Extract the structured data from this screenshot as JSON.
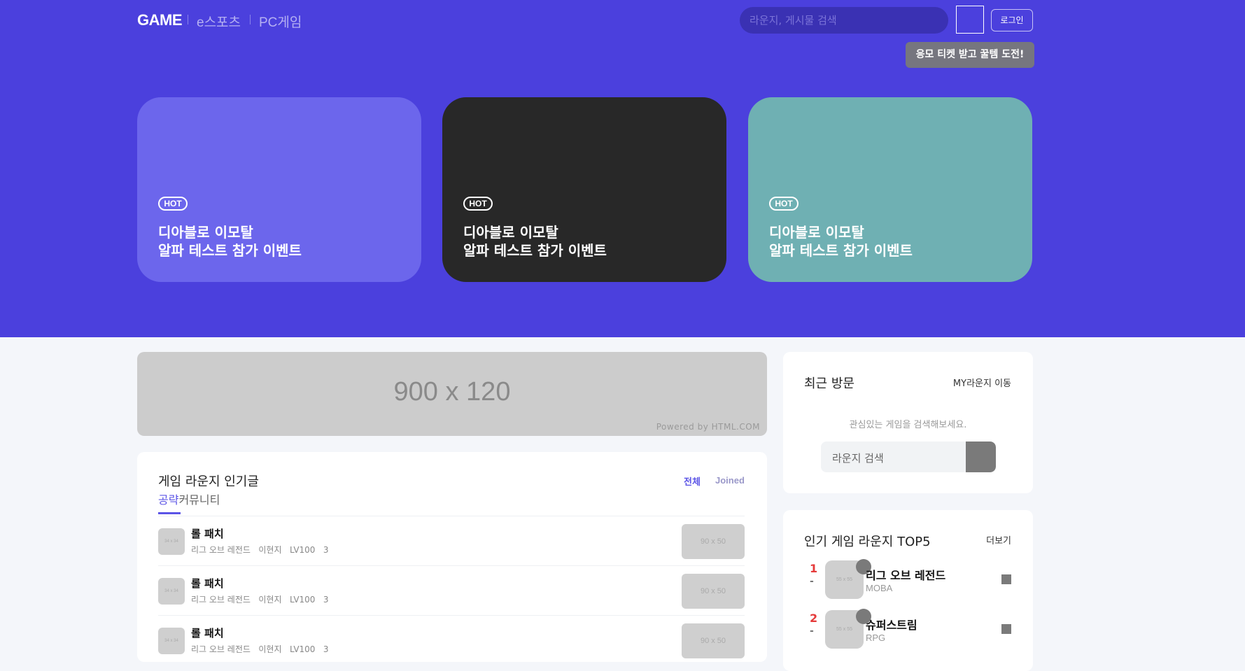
{
  "header": {
    "logo": "GAME",
    "nav": [
      "e스포츠",
      "PC게임"
    ],
    "search_placeholder": "라운지, 게시물 검색",
    "login_label": "로그인",
    "tooltip": "응모 티켓 받고 꿀템 도전!"
  },
  "hero_cards": [
    {
      "badge": "HOT",
      "title_line1": "디아블로 이모탈",
      "title_line2": "알파 테스트 참가 이벤트",
      "color": "#6c66ec"
    },
    {
      "badge": "HOT",
      "title_line1": "디아블로 이모탈",
      "title_line2": "알파 테스트 참가 이벤트",
      "color": "#282828"
    },
    {
      "badge": "HOT",
      "title_line1": "디아블로 이모탈",
      "title_line2": "알파 테스트 참가 이벤트",
      "color": "#6fb0b3"
    }
  ],
  "ad_banner": {
    "size_text": "900 x 120",
    "powered": "Powered by HTML.COM"
  },
  "popular_posts": {
    "title": "게임 라운지 인기글",
    "tabs": [
      "공략",
      "커뮤니티"
    ],
    "filters": [
      "전체",
      "Joined"
    ],
    "items": [
      {
        "thumb": "34 x 34",
        "title": "롤 패치",
        "game": "리그 오브 레전드",
        "author": "이현지",
        "level": "LV100",
        "count": "3",
        "image": "90 x 50"
      },
      {
        "thumb": "34 x 34",
        "title": "롤 패치",
        "game": "리그 오브 레전드",
        "author": "이현지",
        "level": "LV100",
        "count": "3",
        "image": "90 x 50"
      },
      {
        "thumb": "34 x 34",
        "title": "롤 패치",
        "game": "리그 오브 레전드",
        "author": "이현지",
        "level": "LV100",
        "count": "3",
        "image": "90 x 50"
      }
    ]
  },
  "recent_visit": {
    "title": "최근 방문",
    "link": "MY라운지 이동",
    "hint": "관심있는 게임을 검색해보세요.",
    "search_placeholder": "라운지 검색"
  },
  "top5": {
    "title": "인기 게임 라운지 TOP5",
    "more": "더보기",
    "items": [
      {
        "rank": "1",
        "change": "-",
        "thumb": "55 x 55",
        "name": "리그 오브 레전드",
        "genre": "MOBA"
      },
      {
        "rank": "2",
        "change": "-",
        "thumb": "55 x 55",
        "name": "슈퍼스트림",
        "genre": "RPG"
      }
    ]
  },
  "colors": {
    "hero_bg": "#4b40dd",
    "accent": "#5b54e6",
    "rank_red": "#e53a3a"
  }
}
